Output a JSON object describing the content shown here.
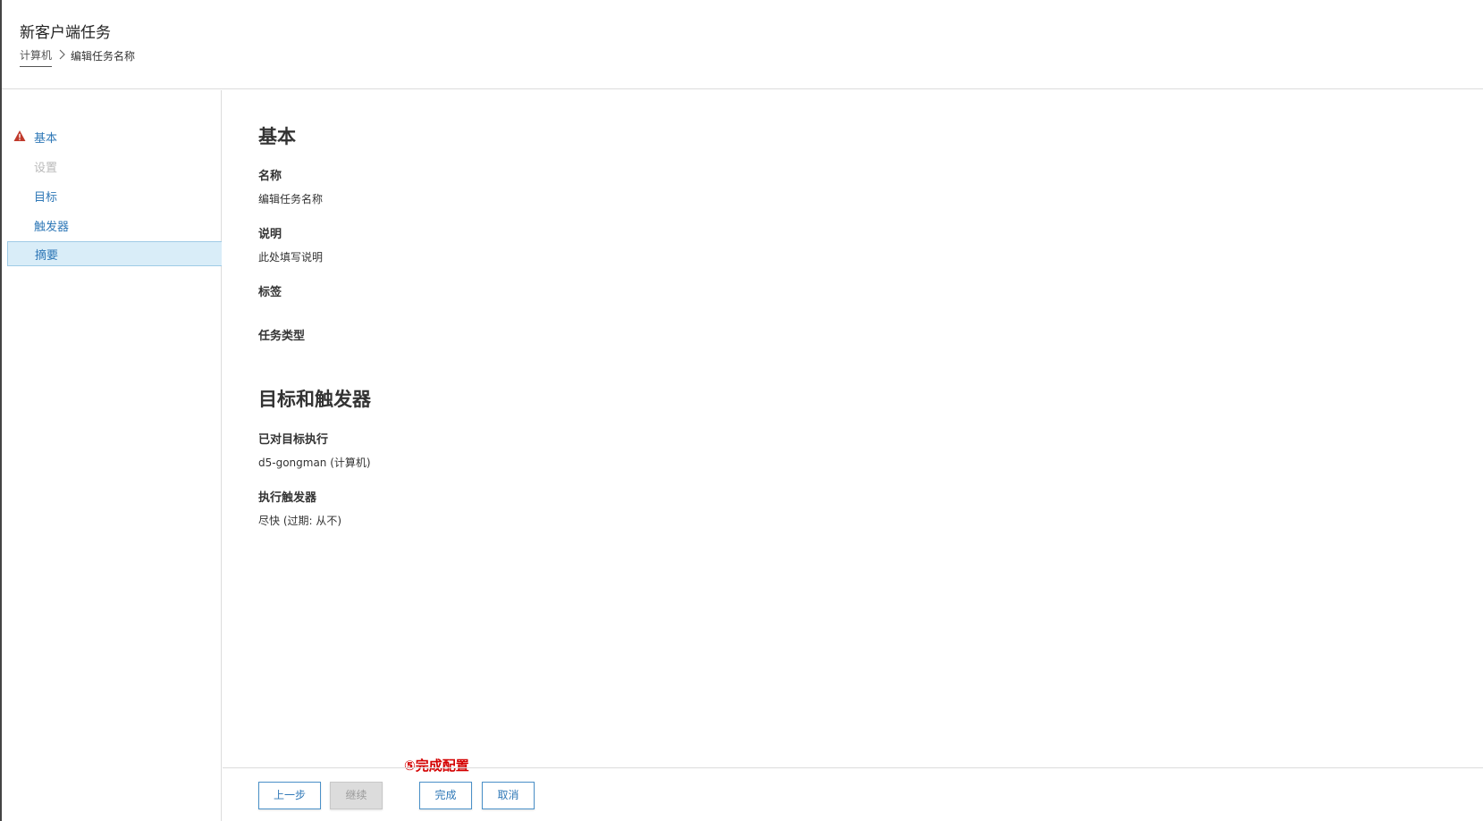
{
  "header": {
    "title": "新客户端任务",
    "breadcrumb": {
      "root": "计算机",
      "separator": "〉",
      "current": "编辑任务名称"
    }
  },
  "sidebar": {
    "items": [
      {
        "label": "基本",
        "state": "warning",
        "icon": "warning-icon"
      },
      {
        "label": "设置",
        "state": "disabled"
      },
      {
        "label": "目标",
        "state": "normal"
      },
      {
        "label": "触发器",
        "state": "normal"
      },
      {
        "label": "摘要",
        "state": "active"
      }
    ]
  },
  "summary": {
    "basic": {
      "title": "基本",
      "name_label": "名称",
      "name_value": "编辑任务名称",
      "desc_label": "说明",
      "desc_value": "此处填写说明",
      "tags_label": "标签",
      "task_type_label": "任务类型"
    },
    "targets": {
      "title": "目标和触发器",
      "executed_label": "已对目标执行",
      "executed_value": "d5-gongman (计算机)",
      "trigger_label": "执行触发器",
      "trigger_value": "尽快 (过期: 从不)"
    }
  },
  "footer": {
    "prev_label": "上一步",
    "continue_label": "继续",
    "finish_label": "完成",
    "cancel_label": "取消"
  },
  "annotation": {
    "text": "⑤完成配置",
    "color": "#d40000"
  },
  "colors": {
    "link": "#2f78b7",
    "active_bg": "#d9edf8",
    "warning": "#c0392b"
  }
}
